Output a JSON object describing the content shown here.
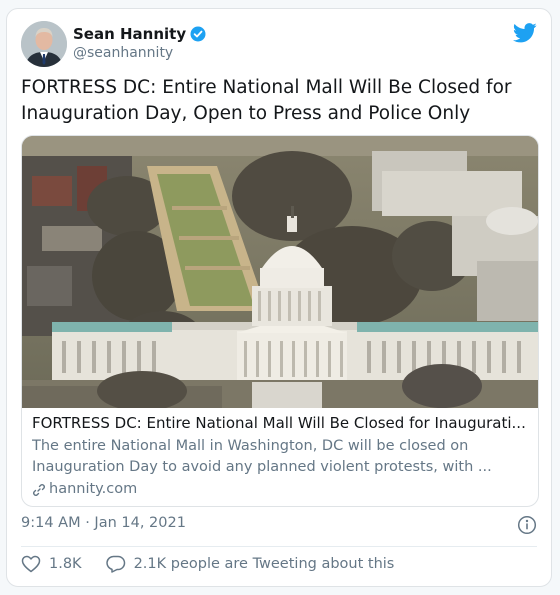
{
  "tweet": {
    "display_name": "Sean Hannity",
    "handle": "@seanhannity",
    "verified": true,
    "text": "FORTRESS DC: Entire National Mall Will Be Closed for Inauguration Day, Open to Press and Police Only",
    "timestamp": "9:14 AM · Jan 14, 2021"
  },
  "link_card": {
    "title": "FORTRESS DC: Entire National Mall Will Be Closed for Inaugurati...",
    "description": "The entire National Mall in Washington, DC will be closed on Inauguration Day to avoid any planned violent protests, with ...",
    "domain": "hannity.com"
  },
  "actions": {
    "likes": "1.8K",
    "tweeting_about": "2.1K people are Tweeting about this"
  },
  "icons": [
    "verified-badge-icon",
    "twitter-bird-icon",
    "link-icon",
    "info-icon",
    "heart-icon",
    "speech-bubble-icon"
  ],
  "colors": {
    "twitter_blue": "#1da1f2",
    "secondary_text": "#657786",
    "primary_text": "#14171a"
  }
}
